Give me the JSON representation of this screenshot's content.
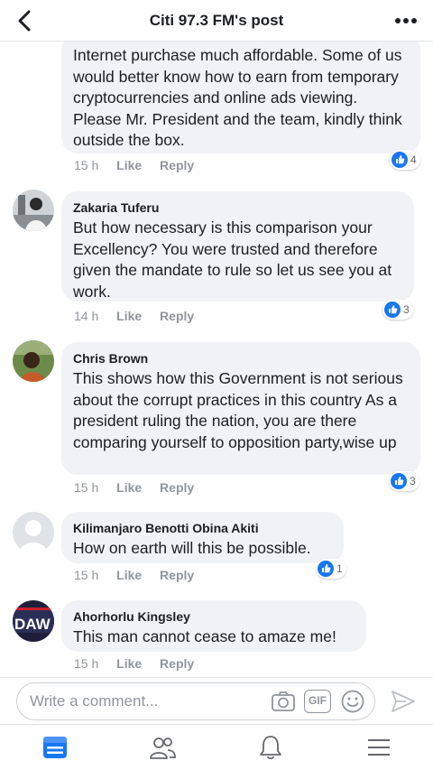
{
  "header": {
    "title": "Citi 97.3 FM's post"
  },
  "comments": [
    {
      "author": "",
      "text": "Internet purchase much affordable. Some of us would better know how to earn from temporary cryptocurrencies and online ads viewing. Please Mr. President and the team, kindly think outside the box.",
      "time": "15 h",
      "like": "Like",
      "reply": "Reply",
      "reactions": "4"
    },
    {
      "author": "Zakaria Tuferu",
      "text": "But how necessary is this comparison your Excellency? You were trusted and therefore given the mandate to rule so let us see you at work.",
      "time": "14 h",
      "like": "Like",
      "reply": "Reply",
      "reactions": "3"
    },
    {
      "author": "Chris Brown",
      "text": "This shows how this Government is not serious about the corrupt practices in this country As a president ruling the nation, you are there comparing yourself to opposition party,wise up",
      "time": "15 h",
      "like": "Like",
      "reply": "Reply",
      "reactions": "3"
    },
    {
      "author": "Kilimanjaro Benotti Obina Akiti",
      "text": "How on earth will this be possible.",
      "time": "15 h",
      "like": "Like",
      "reply": "Reply",
      "reactions": "1"
    },
    {
      "author": "Ahorhorlu Kingsley",
      "text": "This man cannot cease to amaze me!",
      "time": "15 h",
      "like": "Like",
      "reply": "Reply",
      "reactions": ""
    }
  ],
  "avatar_text": {
    "c5": "DAW"
  },
  "composer": {
    "placeholder": "Write a comment...",
    "gif_label": "GIF"
  },
  "icons": [
    "back-arrow-icon",
    "more-icon",
    "camera-icon",
    "gif-icon",
    "emoji-icon",
    "send-icon",
    "news-feed-icon",
    "friends-icon",
    "notifications-icon",
    "menu-icon"
  ],
  "colors": {
    "accent": "#1877f2",
    "bubble": "#f0f2f5",
    "meta": "#90949c"
  }
}
